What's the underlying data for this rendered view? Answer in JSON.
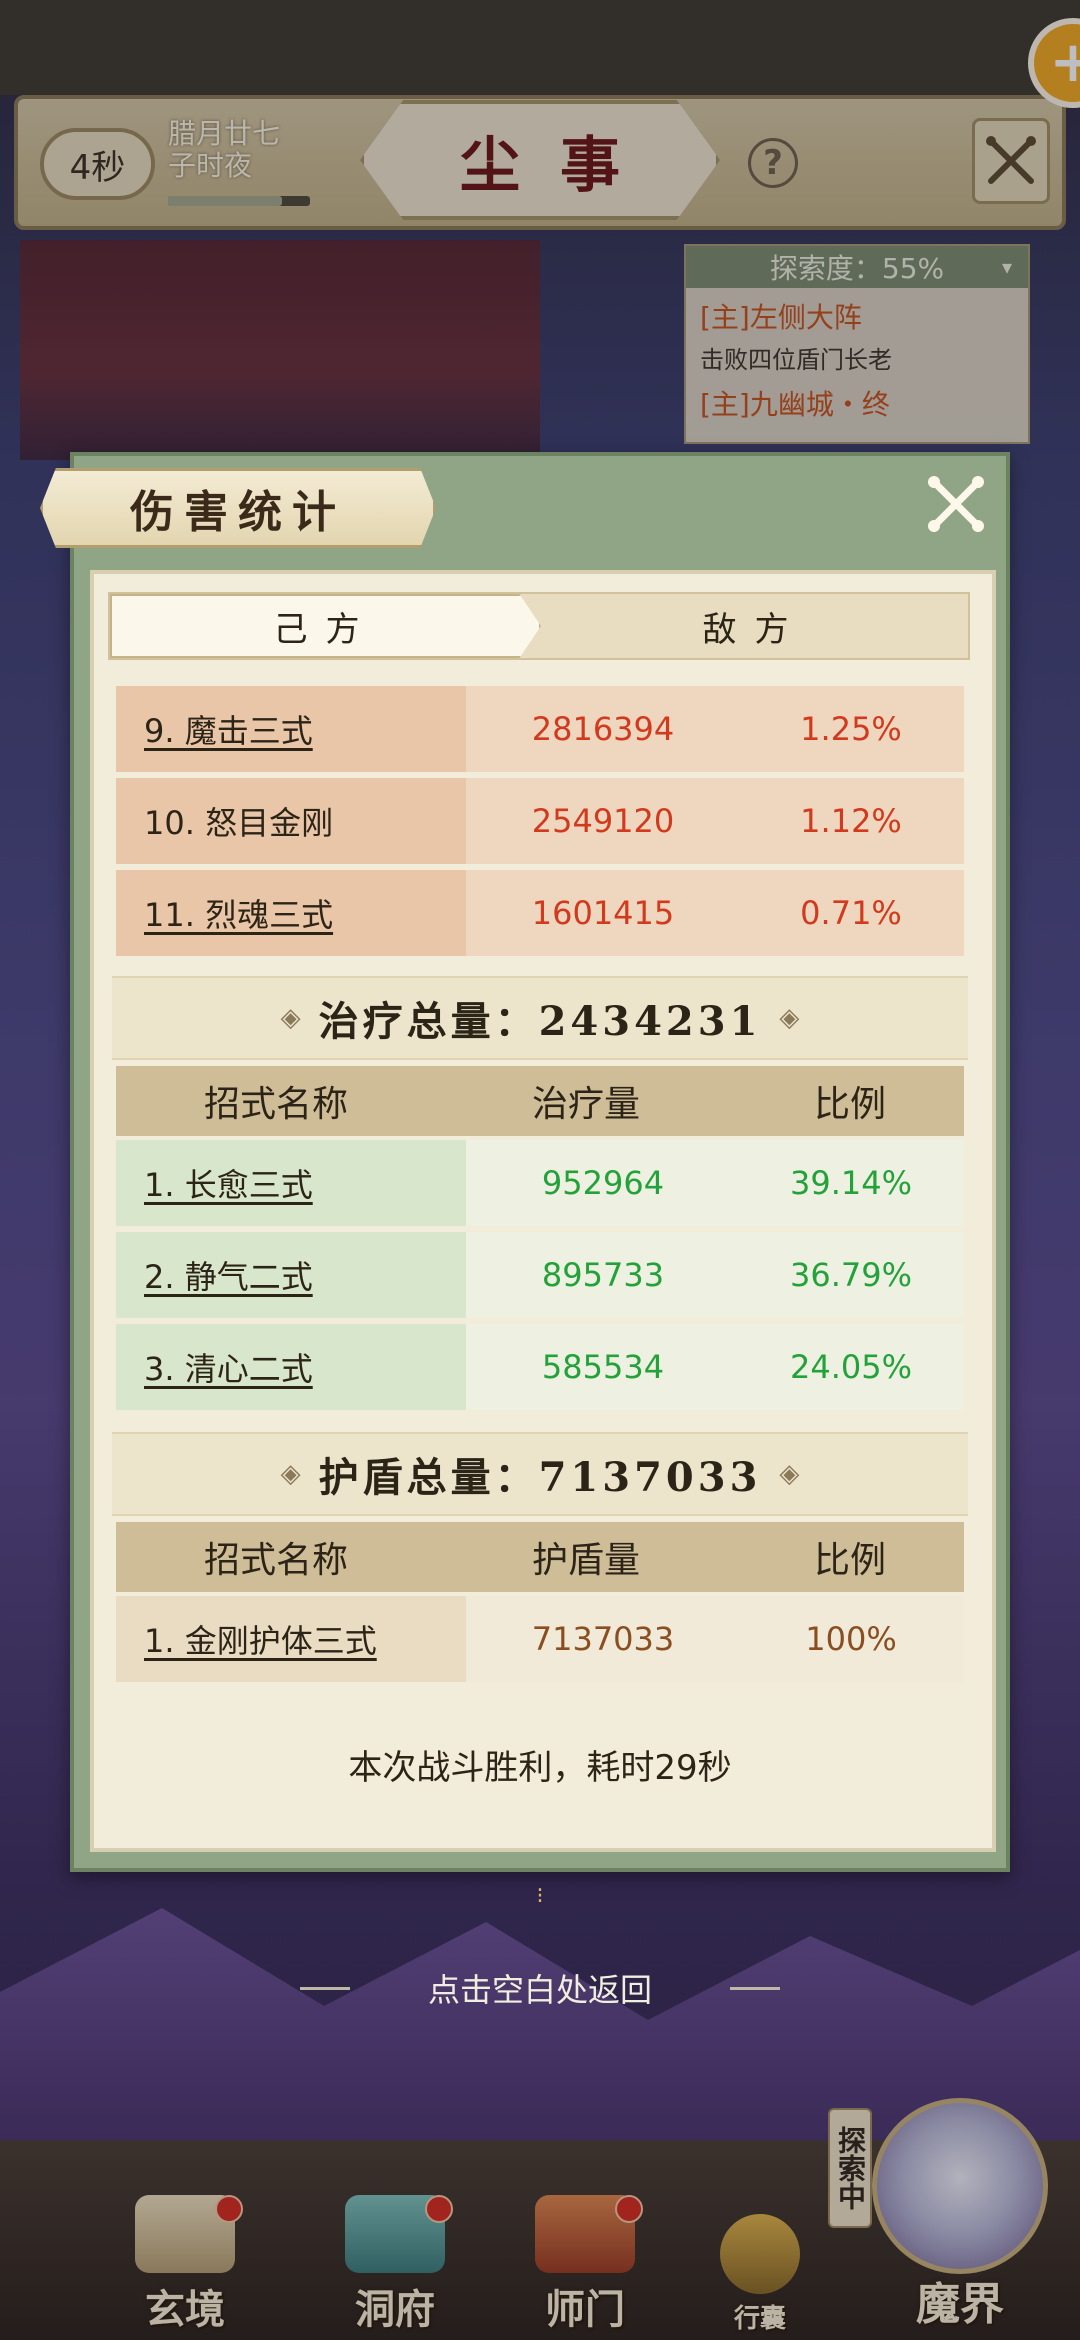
{
  "header": {
    "timer": "4秒",
    "date_line1": "腊月廿七",
    "date_line2": "子时夜",
    "scene_title": "尘事",
    "help_label": "?",
    "plus_label": "+"
  },
  "quest": {
    "progress": "探索度：55%",
    "item1_title": "[主]左侧大阵",
    "item1_desc": "击败四位盾门长老",
    "item2_title": "[主]九幽城・终"
  },
  "modal": {
    "title": "伤害统计",
    "tabs": [
      {
        "label": "己方",
        "active": true
      },
      {
        "label": "敌方",
        "active": false
      }
    ],
    "damage_rows": [
      {
        "name": "9. 魔击三式",
        "value": "2816394",
        "pct": "1.25%"
      },
      {
        "name": "10. 怒目金刚",
        "value": "2549120",
        "pct": "1.12%"
      },
      {
        "name": "11. 烈魂三式",
        "value": "1601415",
        "pct": "0.71%"
      }
    ],
    "heal": {
      "title": "治疗总量：2434231",
      "headers": [
        "招式名称",
        "治疗量",
        "比例"
      ],
      "rows": [
        {
          "name": "1. 长愈三式",
          "value": "952964",
          "pct": "39.14%"
        },
        {
          "name": "2. 静气二式",
          "value": "895733",
          "pct": "36.79%"
        },
        {
          "name": "3. 清心二式",
          "value": "585534",
          "pct": "24.05%"
        }
      ]
    },
    "shield": {
      "title": "护盾总量：7137033",
      "headers": [
        "招式名称",
        "护盾量",
        "比例"
      ],
      "rows": [
        {
          "name": "1. 金刚护体三式",
          "value": "7137033",
          "pct": "100%"
        }
      ]
    },
    "result": "本次战斗胜利，耗时29秒"
  },
  "hint": "点击空白处返回",
  "nav": {
    "items": [
      {
        "label": "玄境"
      },
      {
        "label": "洞府"
      },
      {
        "label": "师门"
      },
      {
        "label": "行囊"
      }
    ],
    "explore_tag": "探索中",
    "magic_label": "魔界"
  },
  "colors": {
    "damage": "#d13a1d",
    "heal": "#24a23a",
    "shield": "#8a4e21",
    "panel_frame": "#8fa585"
  }
}
